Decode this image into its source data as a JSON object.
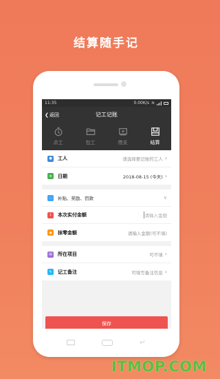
{
  "headline": "结算随手记",
  "status_bar": {
    "time": "11:35",
    "speed": "0.00K/s"
  },
  "titlebar": {
    "back_label": "返回",
    "title": "记工记账"
  },
  "tabs": [
    {
      "label": "点工",
      "icon": "stopwatch-icon",
      "active": false
    },
    {
      "label": "包工",
      "icon": "folder-icon",
      "active": false
    },
    {
      "label": "借支",
      "icon": "money-icon",
      "active": false
    },
    {
      "label": "结算",
      "icon": "settle-icon",
      "active": true
    }
  ],
  "form": {
    "worker": {
      "label": "工人",
      "value": "请选择要记账的工人",
      "icon_color": "#3d8bd9"
    },
    "date": {
      "label": "日期",
      "value": "2018-08-15 (今天)",
      "icon_color": "#4caf50"
    },
    "extras": {
      "label": "补贴、奖励、罚款",
      "icon_color": "#42a5f5"
    },
    "paid_amount": {
      "label": "本次实付金额",
      "placeholder": "请输入金额",
      "icon_color": "#ef5350"
    },
    "discount": {
      "label": "抹零金额",
      "placeholder": "请输入金额(可不填)",
      "icon_color": "#ff9800"
    },
    "project": {
      "label": "所在项目",
      "value": "可不填",
      "icon_color": "#9c6fd6"
    },
    "note": {
      "label": "记工备注",
      "value": "可填写备注信息",
      "icon_color": "#29b6f6"
    }
  },
  "save_label": "保存",
  "watermark": "ITMOP.COM"
}
